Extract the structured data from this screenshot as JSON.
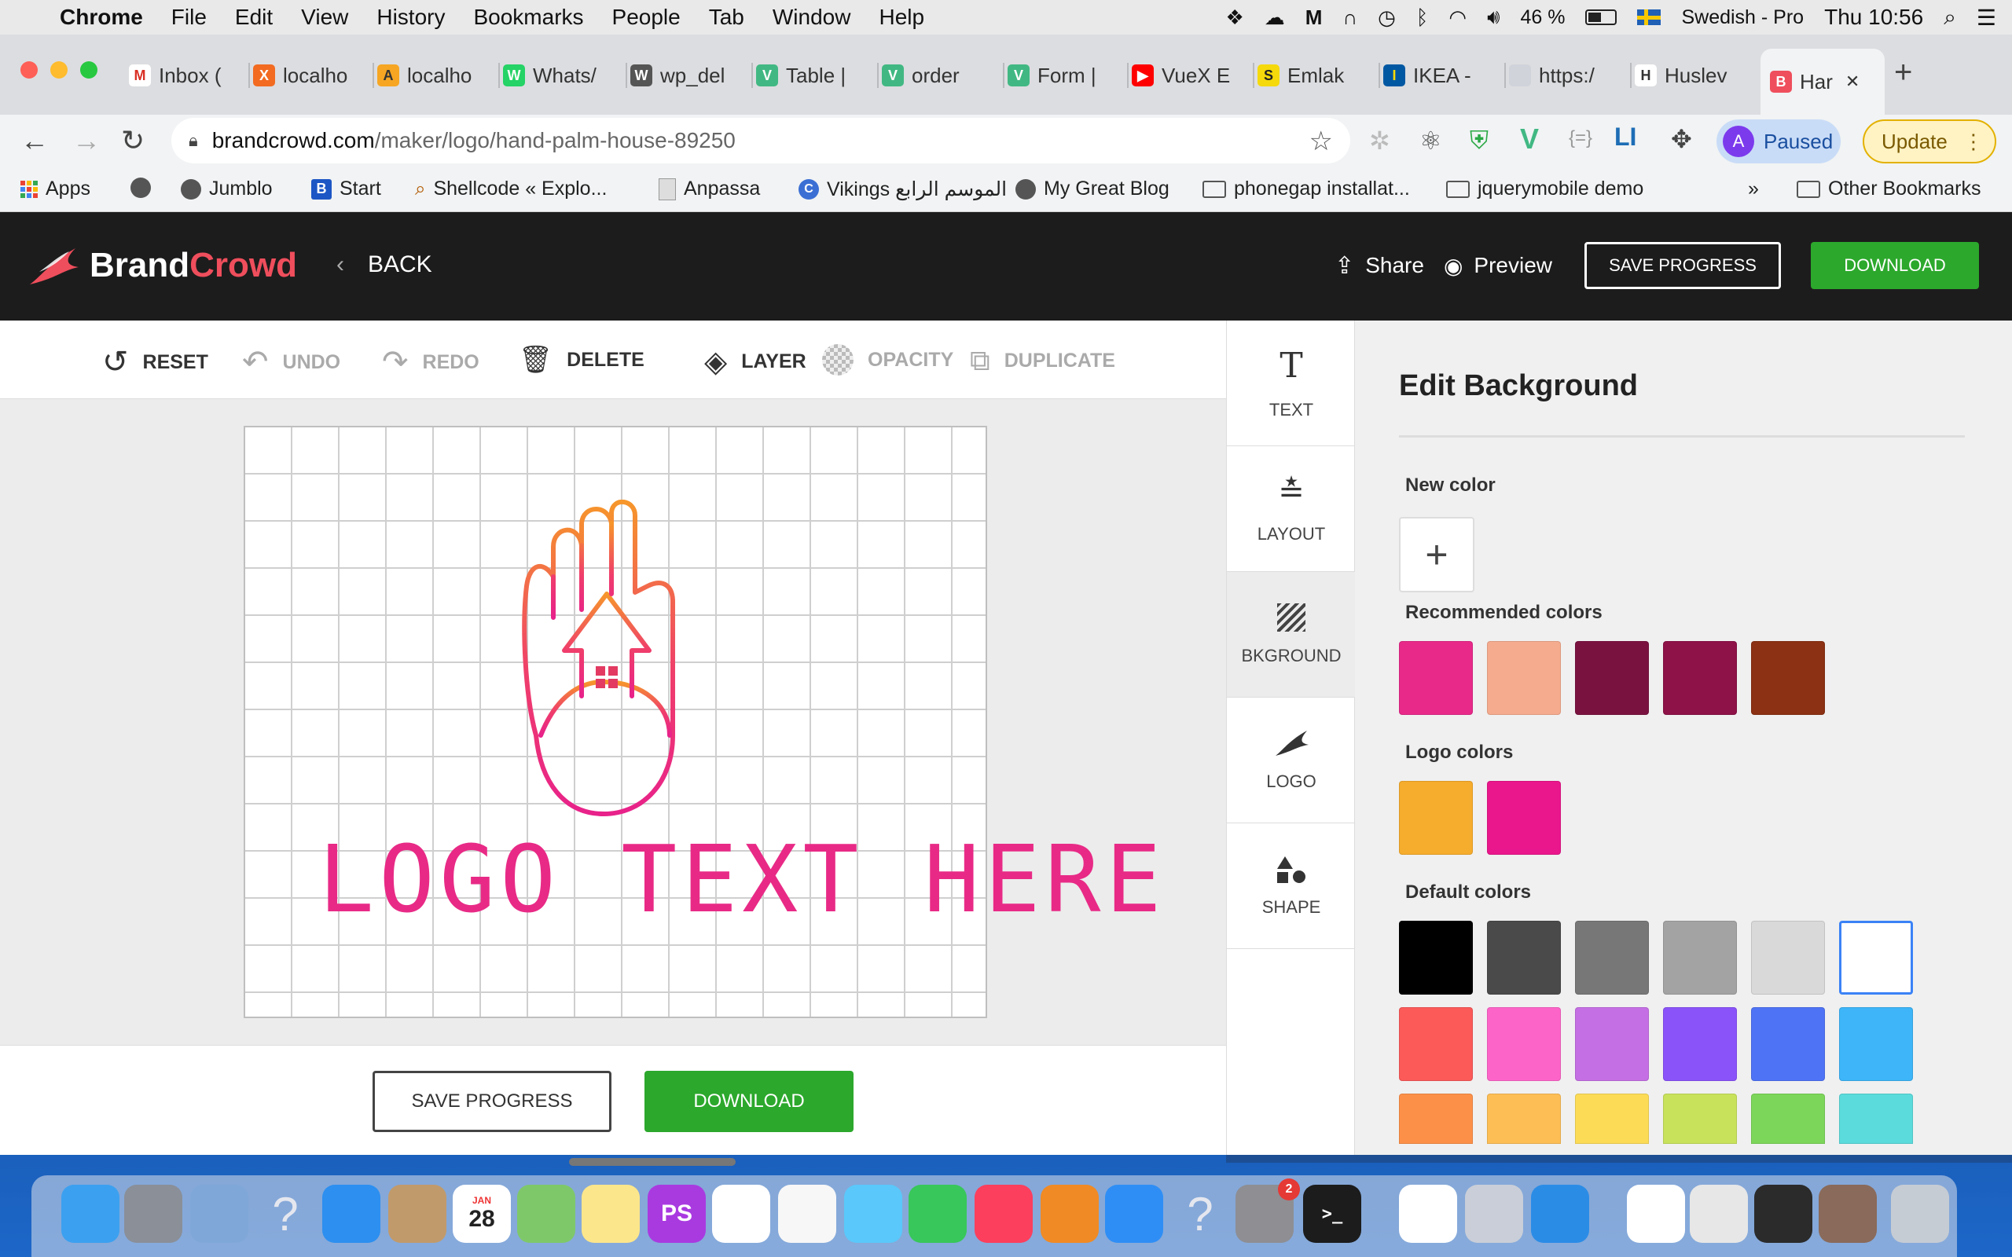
{
  "menubar": {
    "app": "Chrome",
    "items": [
      "File",
      "Edit",
      "View",
      "History",
      "Bookmarks",
      "People",
      "Tab",
      "Window",
      "Help"
    ],
    "battery": "46 %",
    "input_source": "Swedish - Pro",
    "clock": "Thu 10:56"
  },
  "tabs": [
    {
      "label": "Inbox (",
      "fav": "M",
      "color": "#ffffff",
      "fg": "#d93025"
    },
    {
      "label": "localho",
      "fav": "X",
      "color": "#f26b21",
      "fg": "#ffffff"
    },
    {
      "label": "localho",
      "fav": "A",
      "color": "#f6a623",
      "fg": "#333333"
    },
    {
      "label": "Whats/",
      "fav": "W",
      "color": "#25d366",
      "fg": "#ffffff"
    },
    {
      "label": "wp_del",
      "fav": "W",
      "color": "#555555",
      "fg": "#ffffff"
    },
    {
      "label": "Table |",
      "fav": "V",
      "color": "#41b883",
      "fg": "#ffffff"
    },
    {
      "label": "order",
      "fav": "V",
      "color": "#41b883",
      "fg": "#ffffff"
    },
    {
      "label": "Form |",
      "fav": "V",
      "color": "#41b883",
      "fg": "#ffffff"
    },
    {
      "label": "VueX E",
      "fav": "▶",
      "color": "#ff0000",
      "fg": "#ffffff"
    },
    {
      "label": "Emlak",
      "fav": "S",
      "color": "#f5d90a",
      "fg": "#222222"
    },
    {
      "label": "IKEA -",
      "fav": "I",
      "color": "#0058a3",
      "fg": "#ffdb00"
    },
    {
      "label": "https:/",
      "fav": "",
      "color": "#d0d3da",
      "fg": "#ffffff"
    },
    {
      "label": "Huslev",
      "fav": "H",
      "color": "#ffffff",
      "fg": "#333333"
    },
    {
      "label": "Har",
      "fav": "B",
      "color": "#ef4e5c",
      "fg": "#ffffff"
    }
  ],
  "address": {
    "host": "brandcrowd.com",
    "path": "/maker/logo/hand-palm-house-89250",
    "profile_letter": "A",
    "profile_status": "Paused",
    "update_label": "Update"
  },
  "bookmarks": [
    {
      "label": "Apps",
      "icon": "apps-grid"
    },
    {
      "label": "",
      "icon": "globe"
    },
    {
      "label": "Jumblo",
      "icon": "globe"
    },
    {
      "label": "Start",
      "icon": "b-logo"
    },
    {
      "label": "Shellcode « Explo...",
      "icon": "magnifier"
    },
    {
      "label": "Anpassa",
      "icon": "doc"
    },
    {
      "label": "Vikings الموسم الرابع",
      "icon": "c-logo"
    },
    {
      "label": "My Great Blog",
      "icon": "globe"
    },
    {
      "label": "phonegap installat...",
      "icon": "folder"
    },
    {
      "label": "jquerymobile demo",
      "icon": "folder"
    }
  ],
  "bookmarks_overflow": "»",
  "other_bookmarks": "Other Bookmarks",
  "brand": {
    "a": "Brand",
    "b": "Crowd"
  },
  "header": {
    "back": "BACK",
    "share": "Share",
    "preview": "Preview",
    "save": "SAVE PROGRESS",
    "download": "DOWNLOAD"
  },
  "toolbar": {
    "reset": "RESET",
    "undo": "UNDO",
    "redo": "REDO",
    "delete": "DELETE",
    "layer": "LAYER",
    "opacity": "OPACITY",
    "duplicate": "DUPLICATE"
  },
  "canvas": {
    "logo_text": "LOGO TEXT HERE"
  },
  "bottom": {
    "save": "SAVE PROGRESS",
    "download": "DOWNLOAD"
  },
  "sidenav": [
    "TEXT",
    "LAYOUT",
    "BKGROUND",
    "LOGO",
    "SHAPE"
  ],
  "panel": {
    "title": "Edit Background",
    "new_color": "New color",
    "recommended": "Recommended colors",
    "logo_colors": "Logo colors",
    "default_colors": "Default colors",
    "recommended_list": [
      "#e8298a",
      "#f5ab8e",
      "#7a1240",
      "#8e1148",
      "#8c3113"
    ],
    "logo_list": [
      "#f6ac2c",
      "#ea168c"
    ],
    "default_list": [
      "#000000",
      "#4a4a4a",
      "#777777",
      "#a3a3a3",
      "#d9d9d9",
      "#ffffff",
      "#fb5a59",
      "#fd64c8",
      "#c56fe4",
      "#8a53f9",
      "#4f73f5",
      "#3db5f8",
      "#fd9048",
      "#fdbe55",
      "#fcdc57",
      "#c8e25c",
      "#7cd65a",
      "#5bdbdc"
    ]
  },
  "dock": [
    {
      "n": "finder",
      "c": "#3ca0f0"
    },
    {
      "n": "launchpad",
      "c": "#8a8f98"
    },
    {
      "n": "mail-stamp",
      "c": "#7fa8d8"
    },
    {
      "n": "unknown-app",
      "c": "transparent"
    },
    {
      "n": "safari",
      "c": "#2d8ff0"
    },
    {
      "n": "contacts",
      "c": "#c19a6b"
    },
    {
      "n": "calendar",
      "c": "#ffffff"
    },
    {
      "n": "maps",
      "c": "#7fc86a"
    },
    {
      "n": "notes",
      "c": "#fce68b"
    },
    {
      "n": "phpstorm",
      "c": "#a93ae0"
    },
    {
      "n": "reminders",
      "c": "#ffffff"
    },
    {
      "n": "photos",
      "c": "#f7f7f7"
    },
    {
      "n": "messages",
      "c": "#5ac8fa"
    },
    {
      "n": "facetime",
      "c": "#38c75a"
    },
    {
      "n": "music",
      "c": "#fb3f5d"
    },
    {
      "n": "books",
      "c": "#f08a24"
    },
    {
      "n": "app-store",
      "c": "#2f8ef5"
    },
    {
      "n": "unknown-app-2",
      "c": "transparent"
    },
    {
      "n": "system-preferences",
      "c": "#8e8e93"
    },
    {
      "n": "terminal",
      "c": "#1c1c1c"
    },
    {
      "n": "chrome",
      "c": "#ffffff"
    },
    {
      "n": "settings-gear",
      "c": "#c9ced8"
    },
    {
      "n": "vscode",
      "c": "#2b8ce6"
    },
    {
      "n": "document",
      "c": "#ffffff"
    },
    {
      "n": "window-thumb-1",
      "c": "#e7e7e7"
    },
    {
      "n": "window-thumb-2",
      "c": "#2b2b2b"
    },
    {
      "n": "window-thumb-3",
      "c": "#8a6a5a"
    },
    {
      "n": "trash",
      "c": "#c6ccd4"
    }
  ],
  "dock_calendar_day": "28",
  "dock_calendar_month": "JAN",
  "dock_badge": "2"
}
